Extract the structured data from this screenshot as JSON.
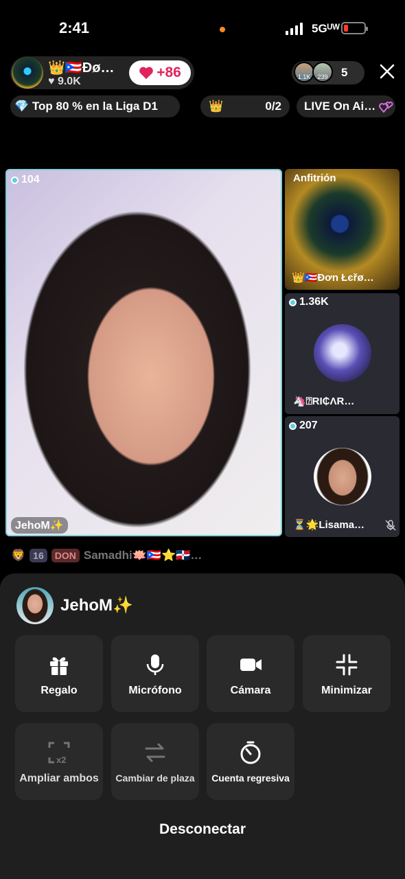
{
  "status_bar": {
    "time": "2:41",
    "network": "5Gᵁᵂ"
  },
  "host": {
    "name": "👑🇵🇷Đø…",
    "likes": "♥ 9.0K",
    "heart_label": "+86",
    "viewer_avatars": [
      "1.1K",
      "239"
    ],
    "viewer_count": "5"
  },
  "chips": {
    "league": "💎 Top 80 % en la Liga D1",
    "crown_icon": "👑",
    "crown_progress": "0/2",
    "live_label": "LIVE On Ai…"
  },
  "main_tile": {
    "count": "104",
    "name": "JehoM✨"
  },
  "side_tiles": [
    {
      "top_label": "Anfitrión",
      "name": "👑🇵🇷Đơn Łєřø…"
    },
    {
      "count": "1.36K",
      "name": "🦄⍰RI₵ΛR…"
    },
    {
      "count": "207",
      "name": "⏳🌟Lisama…"
    }
  ],
  "badges_row": {
    "b1": "16",
    "b2": "DON",
    "text": "Samadhi🪷🇵🇷⭐🇩🇴…"
  },
  "sheet": {
    "guest_name": "JehoM✨",
    "buttons": {
      "gift": "Regalo",
      "mic": "Micrófono",
      "camera": "Cámara",
      "minimize": "Minimizar",
      "expand": "Ampliar ambos",
      "swap": "Cambiar de plaza",
      "countdown": "Cuenta regresiva"
    },
    "disconnect": "Desconectar"
  },
  "colors": {
    "accent_heart": "#e0245e",
    "tile_border": "#7fd0d8",
    "sheet_bg": "#1f1f1f"
  }
}
